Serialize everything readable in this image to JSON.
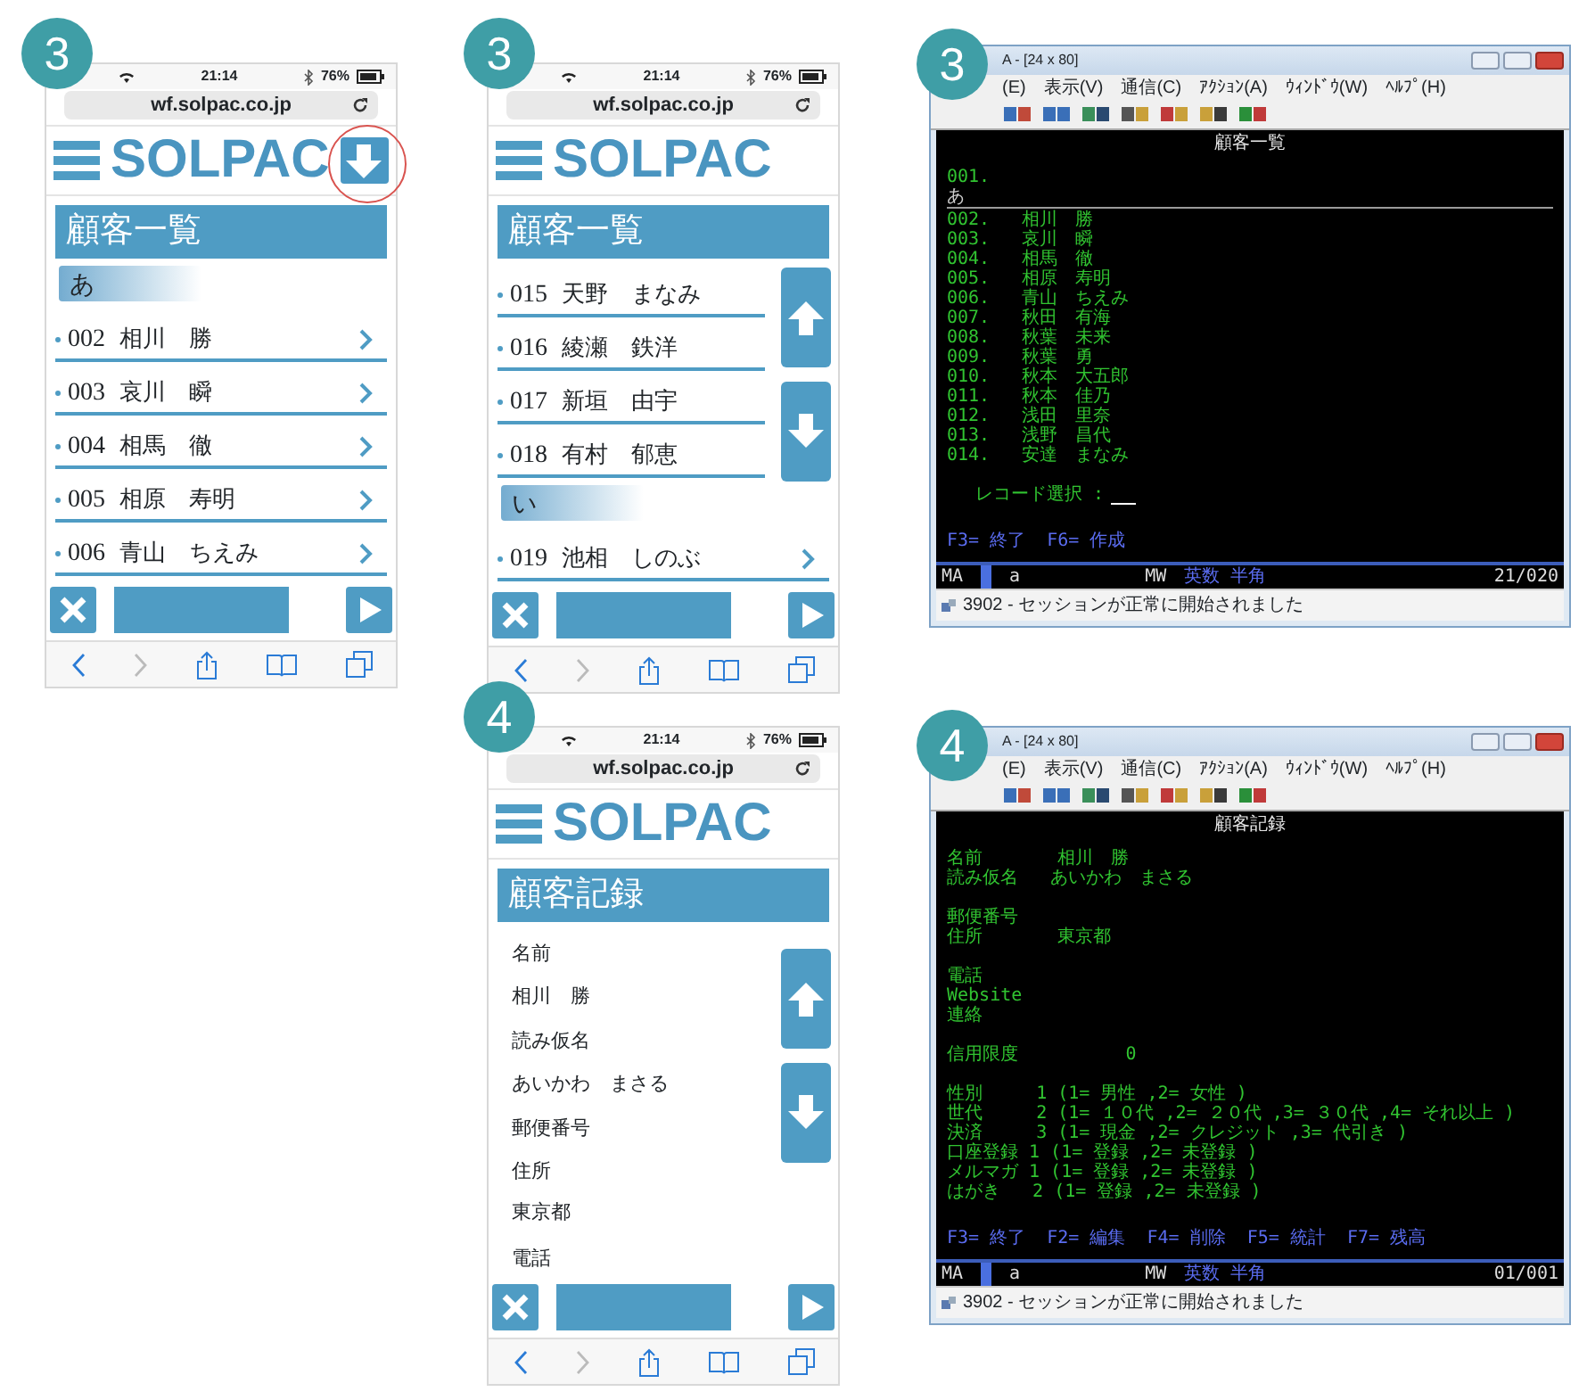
{
  "panels": [
    {
      "kind": "phone",
      "badge": "3",
      "time": "21:14",
      "battery": "76%",
      "url": "wf.solpac.co.jp",
      "logo": "SOLPAC",
      "download_button": true,
      "download_highlighted": true,
      "title": "顧客一覧",
      "scroll_buttons": false,
      "list": [
        {
          "kind": "section",
          "label": "あ"
        },
        {
          "kind": "item",
          "number": "002",
          "name": "相川　勝",
          "chevron": true
        },
        {
          "kind": "item",
          "number": "003",
          "name": "哀川　瞬",
          "chevron": true
        },
        {
          "kind": "item",
          "number": "004",
          "name": "相馬　徹",
          "chevron": true
        },
        {
          "kind": "item",
          "number": "005",
          "name": "相原　寿明",
          "chevron": true
        },
        {
          "kind": "item",
          "number": "006",
          "name": "青山　ちえみ",
          "chevron": true
        }
      ]
    },
    {
      "kind": "phone",
      "badge": "3",
      "time": "21:14",
      "battery": "76%",
      "url": "wf.solpac.co.jp",
      "logo": "SOLPAC",
      "title": "顧客一覧",
      "scroll_buttons": true,
      "list": [
        {
          "kind": "item",
          "number": "015",
          "name": "天野　まなみ",
          "chevron": false
        },
        {
          "kind": "item",
          "number": "016",
          "name": "綾瀬　鉄洋",
          "chevron": false
        },
        {
          "kind": "item",
          "number": "017",
          "name": "新垣　由宇",
          "chevron": false
        },
        {
          "kind": "item",
          "number": "018",
          "name": "有村　郁恵",
          "chevron": false
        },
        {
          "kind": "section",
          "label": "い"
        },
        {
          "kind": "item",
          "number": "019",
          "name": "池相　しのぶ",
          "chevron": true
        }
      ]
    },
    {
      "kind": "terminal",
      "badge": "3",
      "window_title": "A - [24 x 80]",
      "menu": [
        "(E)",
        "表示(V)",
        "通信(C)",
        "ｱｸｼｮﾝ(A)",
        "ｳｨﾝﾄﾞｳ(W)",
        "ﾍﾙﾌﾟ(H)"
      ],
      "screen_title": "顧客一覧",
      "lines": [
        {
          "kind": "text",
          "text": "001."
        },
        {
          "kind": "heading",
          "text": "あ"
        },
        {
          "kind": "text",
          "text": "002.   相川　勝"
        },
        {
          "kind": "text",
          "text": "003.   哀川　瞬"
        },
        {
          "kind": "text",
          "text": "004.   相馬　徹"
        },
        {
          "kind": "text",
          "text": "005.   相原　寿明"
        },
        {
          "kind": "text",
          "text": "006.   青山　ちえみ"
        },
        {
          "kind": "text",
          "text": "007.   秋田　有海"
        },
        {
          "kind": "text",
          "text": "008.   秋葉　未来"
        },
        {
          "kind": "text",
          "text": "009.   秋葉　勇"
        },
        {
          "kind": "text",
          "text": "010.   秋本　大五郎"
        },
        {
          "kind": "text",
          "text": "011.   秋本　佳乃"
        },
        {
          "kind": "text",
          "text": "012.   浅田　里奈"
        },
        {
          "kind": "text",
          "text": "013.   浅野　昌代"
        },
        {
          "kind": "text",
          "text": "014.   安達　まなみ"
        },
        {
          "kind": "blank"
        },
        {
          "kind": "prompt",
          "text": "レコード選択 :"
        },
        {
          "kind": "blank"
        },
        {
          "kind": "keys",
          "text": "F3= 終了  F6= 作成"
        }
      ],
      "oia": {
        "session": "MA",
        "mode": "a",
        "device": "MW",
        "input": "英数 半角",
        "position": "21/020"
      },
      "status": "3902 - セッションが正常に開始されました"
    },
    {
      "kind": "phone",
      "badge": "4",
      "time": "21:14",
      "battery": "76%",
      "url": "wf.solpac.co.jp",
      "logo": "SOLPAC",
      "title": "顧客記録",
      "scroll_buttons": true,
      "fields": [
        {
          "label": "名前",
          "value": "相川　勝"
        },
        {
          "label": "読み仮名",
          "value": "あいかわ　まさる"
        },
        {
          "label": "郵便番号"
        },
        {
          "label": "住所",
          "value": "東京都"
        },
        {
          "label": "電話"
        }
      ]
    },
    {
      "kind": "terminal",
      "badge": "4",
      "window_title": "A - [24 x 80]",
      "menu": [
        "(E)",
        "表示(V)",
        "通信(C)",
        "ｱｸｼｮﾝ(A)",
        "ｳｨﾝﾄﾞｳ(W)",
        "ﾍﾙﾌﾟ(H)"
      ],
      "screen_title": "顧客記録",
      "lines": [
        {
          "kind": "text",
          "text": "名前       相川　勝"
        },
        {
          "kind": "text",
          "text": "読み仮名   あいかわ　まさる"
        },
        {
          "kind": "blank"
        },
        {
          "kind": "text",
          "text": "郵便番号"
        },
        {
          "kind": "text",
          "text": "住所       東京都"
        },
        {
          "kind": "blank"
        },
        {
          "kind": "text",
          "text": "電話"
        },
        {
          "kind": "text",
          "text": "Website"
        },
        {
          "kind": "text",
          "text": "連絡"
        },
        {
          "kind": "blank"
        },
        {
          "kind": "text",
          "text": "信用限度          0"
        },
        {
          "kind": "blank"
        },
        {
          "kind": "text",
          "text": "性別     1 (1= 男性 ,2= 女性 )"
        },
        {
          "kind": "text",
          "text": "世代     2 (1= １０代 ,2= ２０代 ,3= ３０代 ,4= それ以上 )"
        },
        {
          "kind": "text",
          "text": "決済     3 (1= 現金 ,2= クレジット ,3= 代引き )"
        },
        {
          "kind": "text",
          "text": "口座登録 1 (1= 登録 ,2= 未登録 )"
        },
        {
          "kind": "text",
          "text": "メルマガ 1 (1= 登録 ,2= 未登録 )"
        },
        {
          "kind": "text",
          "text": "はがき   2 (1= 登録 ,2= 未登録 )"
        },
        {
          "kind": "blank"
        },
        {
          "kind": "keys",
          "text": "F3= 終了  F2= 編集  F4= 削除  F5= 統計  F7= 残高"
        }
      ],
      "oia": {
        "session": "MA",
        "mode": "a",
        "device": "MW",
        "input": "英数 半角",
        "position": "01/001"
      },
      "status": "3902 - セッションが正常に開始されました"
    }
  ]
}
